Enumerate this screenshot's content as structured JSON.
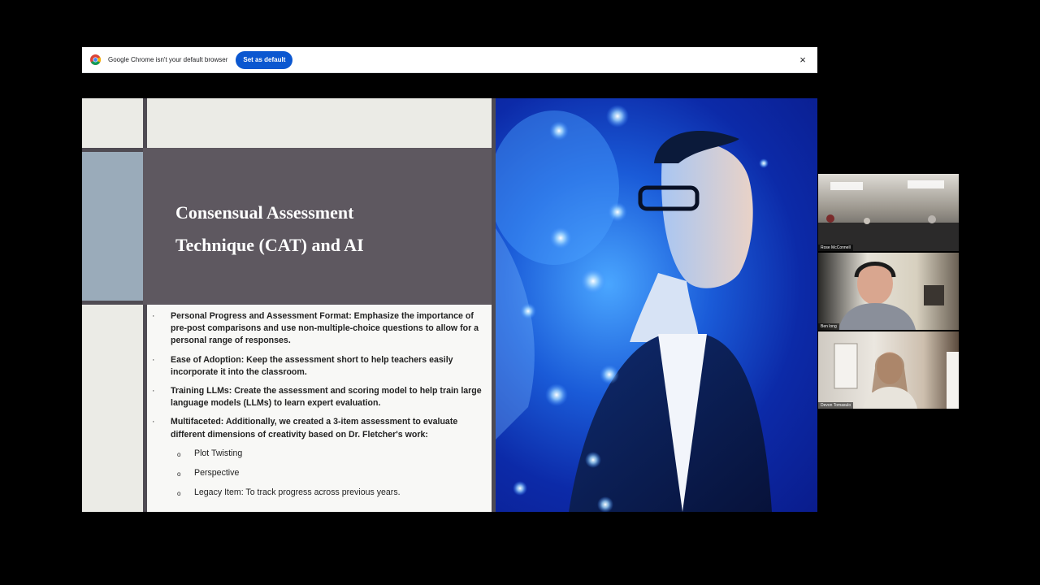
{
  "browser": {
    "infobar_message": "Google Chrome isn't your default browser",
    "set_default_label": "Set as default",
    "close_glyph": "×"
  },
  "slide": {
    "title_line1": "Consensual Assessment",
    "title_line2": "Technique (CAT) and AI",
    "bullets": [
      "Personal Progress and Assessment Format: Emphasize the importance of pre-post comparisons and use non-multiple-choice questions to allow for a personal range of responses.",
      "Ease of Adoption: Keep the assessment short to help teachers easily incorporate it into the classroom.",
      "Training LLMs: Create the assessment and scoring model to help train large language models (LLMs) to learn expert evaluation.",
      "Multifaceted: Additionally, we created a 3-item assessment to evaluate different dimensions of creativity based on Dr. Fletcher's work:"
    ],
    "sub_bullets": [
      "Plot Twisting",
      "Perspective",
      "Legacy Item: To track progress across previous years."
    ],
    "bullet_glyph": "·",
    "sub_bullet_glyph": "o"
  },
  "participants": [
    {
      "name": "Rose McConnell"
    },
    {
      "name": "Ben long"
    },
    {
      "name": "Devon Tomasulo"
    }
  ]
}
